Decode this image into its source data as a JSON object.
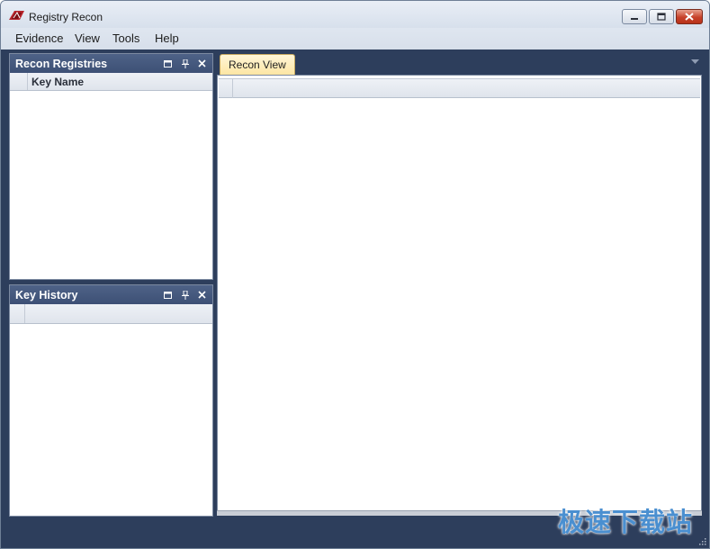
{
  "window": {
    "title": "Registry Recon",
    "controls": {
      "minimize": "minimize",
      "restore": "restore",
      "close": "close"
    }
  },
  "menu": {
    "items": [
      {
        "label": "Evidence"
      },
      {
        "label": "View"
      },
      {
        "label": "Tools"
      },
      {
        "label": "Help"
      }
    ]
  },
  "panes": {
    "recon_registries": {
      "title": "Recon Registries",
      "column_header": "Key Name"
    },
    "key_history": {
      "title": "Key History",
      "column_header": ""
    }
  },
  "document": {
    "tabs": [
      {
        "label": "Recon View",
        "active": true
      }
    ]
  },
  "watermark": {
    "text": "极速下载站"
  },
  "colors": {
    "dock_background": "#2d3e5c",
    "pane_header": "#46597e",
    "active_tab": "#fde6a3",
    "close_button": "#c7412a"
  }
}
